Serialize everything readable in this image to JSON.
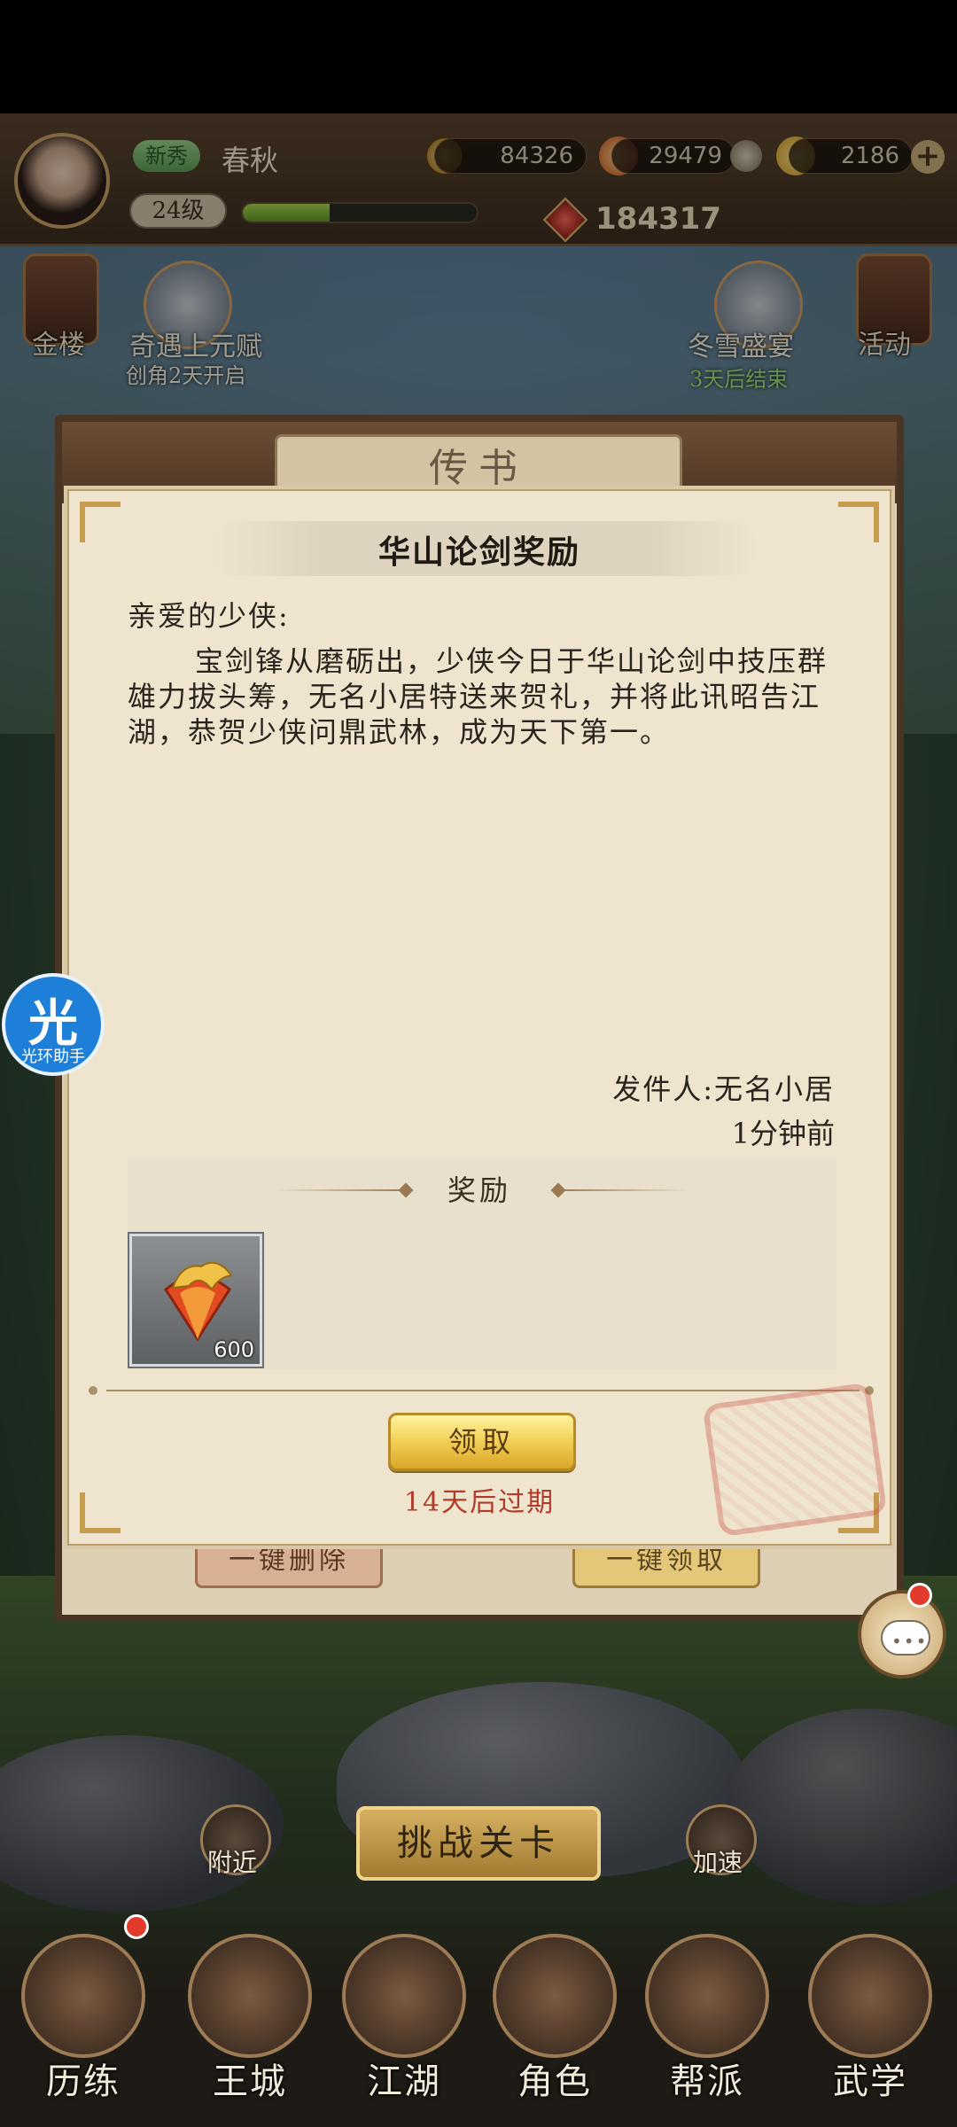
{
  "hud": {
    "vip": "新秀",
    "player_name": "春秋",
    "level": "24级",
    "exp_fraction": 0.37,
    "coins": "84326",
    "gems": "29479",
    "gold": "2186",
    "power": "184317"
  },
  "side_icons": {
    "gold_tower": "金楼",
    "activity": "活动"
  },
  "events": {
    "left_title": "奇遇上元赋",
    "left_sub": "创角2天开启",
    "right_title": "冬雪盛宴",
    "right_sub": "3天后结束"
  },
  "mail_panel": {
    "tab_title": "传书",
    "delete_all": "一键删除",
    "claim_all": "一键领取"
  },
  "letter": {
    "title": "华山论剑奖励",
    "greeting": "亲爱的少侠:",
    "body": "宝剑锋从磨砺出，少侠今日于华山论剑中技压群雄力拔头筹，无名小居特送来贺礼，并将此讯昭告江湖，恭贺少侠问鼎武林，成为天下第一。",
    "sender": "发件人:无名小居",
    "time": "1分钟前",
    "reward_label": "奖励",
    "reward_item_count": "600",
    "claim_button": "领取",
    "expire_text": "14天后过期"
  },
  "helper": {
    "glyph": "光",
    "label": "光环助手"
  },
  "bottom": {
    "nearby": "附近",
    "challenge": "挑战关卡",
    "speedup": "加速"
  },
  "nav": {
    "items": [
      "历练",
      "王城",
      "江湖",
      "角色",
      "帮派",
      "武学"
    ]
  },
  "colors": {
    "expire_red": "#b23a2a",
    "claim_gold": "#f3d25a",
    "helper_blue": "#1e7fd8"
  }
}
